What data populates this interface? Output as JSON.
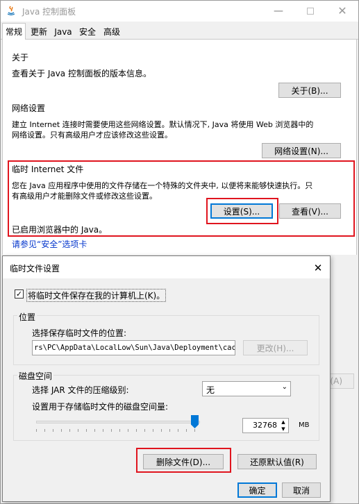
{
  "main_window": {
    "title": "Java 控制面板",
    "tabs": [
      "常规",
      "更新",
      "Java",
      "安全",
      "高级"
    ],
    "about": {
      "heading": "关于",
      "desc": "查看关于 Java 控制面板的版本信息。",
      "button": "关于(B)..."
    },
    "network": {
      "heading": "网络设置",
      "desc_line1": "建立 Internet 连接时需要使用这些网络设置。默认情况下, Java 将使用 Web 浏览器中的",
      "desc_line2": "网络设置。只有高级用户才应该修改这些设置。",
      "button": "网络设置(N)..."
    },
    "temp": {
      "heading": "临时 Internet 文件",
      "desc_line1": "您在 Java 应用程序中使用的文件存储在一个特殊的文件夹中, 以便将来能够快速执行。只",
      "desc_line2": "有高级用户才能删除文件或修改这些设置。",
      "settings_button": "设置(S)...",
      "view_button": "查看(V)..."
    },
    "browser_status": "已启用浏览器中的 Java。",
    "security_link": "请参见“安全”选项卡",
    "apply_peek": "(A)"
  },
  "dialog": {
    "title": "临时文件设置",
    "keep_checkbox": "将临时文件保存在我的计算机上(K)。",
    "keep_checked": true,
    "location": {
      "group": "位置",
      "label": "选择保存临时文件的位置:",
      "path": "rs\\PC\\AppData\\LocalLow\\Sun\\Java\\Deployment\\cache",
      "change_button": "更改(H)..."
    },
    "disk": {
      "group": "磁盘空间",
      "compress_label": "选择 JAR 文件的压缩级别:",
      "compress_value": "无",
      "space_label": "设置用于存储临时文件的磁盘空间量:",
      "slider_fraction": 0.99,
      "space_value": "32768",
      "unit": "MB"
    },
    "delete_button": "删除文件(D)...",
    "restore_button": "还原默认值(R)",
    "ok_button": "确定",
    "cancel_button": "取消"
  }
}
